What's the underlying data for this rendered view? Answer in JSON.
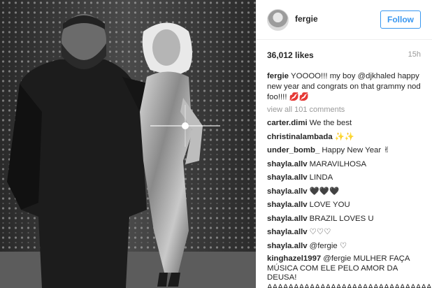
{
  "post": {
    "username": "fergie",
    "follow_label": "Follow",
    "likes": "36,012 likes",
    "time": "15h",
    "caption": {
      "username": "fergie",
      "text": "YOOOO!!! my boy @djkhaled happy new year and congrats on that grammy nod foo!!!! 💋💋"
    },
    "view_all": "view all 101 comments",
    "comments": [
      {
        "username": "carter.dimi",
        "text": "We the best"
      },
      {
        "username": "christinalambada",
        "text": "✨✨"
      },
      {
        "username": "under_bomb_",
        "text": "Happy New Year ✌"
      },
      {
        "username": "shayla.allv",
        "text": "MARAVILHOSA"
      },
      {
        "username": "shayla.allv",
        "text": "LINDA"
      },
      {
        "username": "shayla.allv",
        "text": "🖤🖤🖤"
      },
      {
        "username": "shayla.allv",
        "text": "LOVE YOU"
      },
      {
        "username": "shayla.allv",
        "text": "BRAZIL LOVES U"
      },
      {
        "username": "shayla.allv",
        "text": "♡♡♡"
      },
      {
        "username": "shayla.allv",
        "text": "@fergie ♡"
      },
      {
        "username": "kinghazel1997",
        "text": "@fergie MULHER FAÇA MÚSICA COM ELE PELO AMOR DA DEUSA! AAAAAAAAAAAAAAAAAAAAAAAAAAAAAAAA"
      }
    ]
  },
  "colors": {
    "accent": "#3897f0",
    "text": "#262626",
    "muted": "#999999",
    "photo_bg": "#1a1a1a"
  },
  "icons": [
    "avatar"
  ]
}
